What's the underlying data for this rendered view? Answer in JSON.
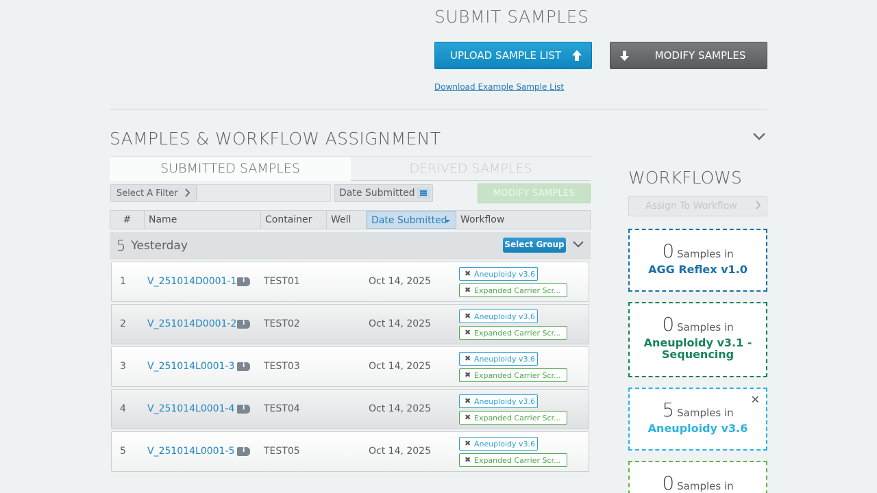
{
  "submit": {
    "title": "SUBMIT SAMPLES",
    "upload_label": "UPLOAD SAMPLE LIST",
    "modify_label": "MODIFY SAMPLES",
    "download_link": "Download Example Sample List"
  },
  "section": {
    "title": "SAMPLES & WORKFLOW ASSIGNMENT"
  },
  "tabs": [
    {
      "label": "SUBMITTED SAMPLES",
      "active": true
    },
    {
      "label": "DERIVED SAMPLES",
      "active": false
    }
  ],
  "toolbar": {
    "filter_label": "Select A Filter",
    "date_filter_label": "Date Submitted",
    "modify_label": "MODIFY SAMPLES"
  },
  "table": {
    "headers": [
      "#",
      "Name",
      "Container",
      "Well",
      "Date Submitted",
      "Workflow"
    ],
    "group": {
      "count": "5",
      "label": "Yesterday",
      "select_label": "Select Group"
    },
    "rows": [
      {
        "num": "1",
        "name": "V_251014D0001-1",
        "container": "TEST01",
        "well": "",
        "date": "Oct 14, 2025",
        "tags": [
          "Aneuploidy v3.6",
          "Expanded Carrier Scr..."
        ]
      },
      {
        "num": "2",
        "name": "V_251014D0001-2",
        "container": "TEST02",
        "well": "",
        "date": "Oct 14, 2025",
        "tags": [
          "Aneuploidy v3.6",
          "Expanded Carrier Scr..."
        ]
      },
      {
        "num": "3",
        "name": "V_251014L0001-3",
        "container": "TEST03",
        "well": "",
        "date": "Oct 14, 2025",
        "tags": [
          "Aneuploidy v3.6",
          "Expanded Carrier Scr..."
        ]
      },
      {
        "num": "4",
        "name": "V_251014L0001-4",
        "container": "TEST04",
        "well": "",
        "date": "Oct 14, 2025",
        "tags": [
          "Aneuploidy v3.6",
          "Expanded Carrier Scr..."
        ]
      },
      {
        "num": "5",
        "name": "V_251014L0001-5",
        "container": "TEST05",
        "well": "",
        "date": "Oct 14, 2025",
        "tags": [
          "Aneuploidy v3.6",
          "Expanded Carrier Scr..."
        ]
      }
    ]
  },
  "workflows": {
    "title": "WORKFLOWS",
    "assign_label": "Assign To Workflow",
    "cards": [
      {
        "count": "0",
        "samples_label": "Samples in",
        "name": "AGG Reflex v1.0",
        "color": "#1a6fa8"
      },
      {
        "count": "0",
        "samples_label": "Samples in",
        "name": "Aneuploidy v3.1 - Sequencing",
        "color": "#17845a"
      },
      {
        "count": "5",
        "samples_label": "Samples in",
        "name": "Aneuploidy v3.6",
        "color": "#2bb3e0"
      },
      {
        "count": "0",
        "samples_label": "Samples in",
        "name": "",
        "color": "#63b446"
      }
    ]
  },
  "colors": {
    "accent_blue": "#1f86c4",
    "tag_blue": "#2e9ed6",
    "tag_green": "#4ca64c"
  }
}
